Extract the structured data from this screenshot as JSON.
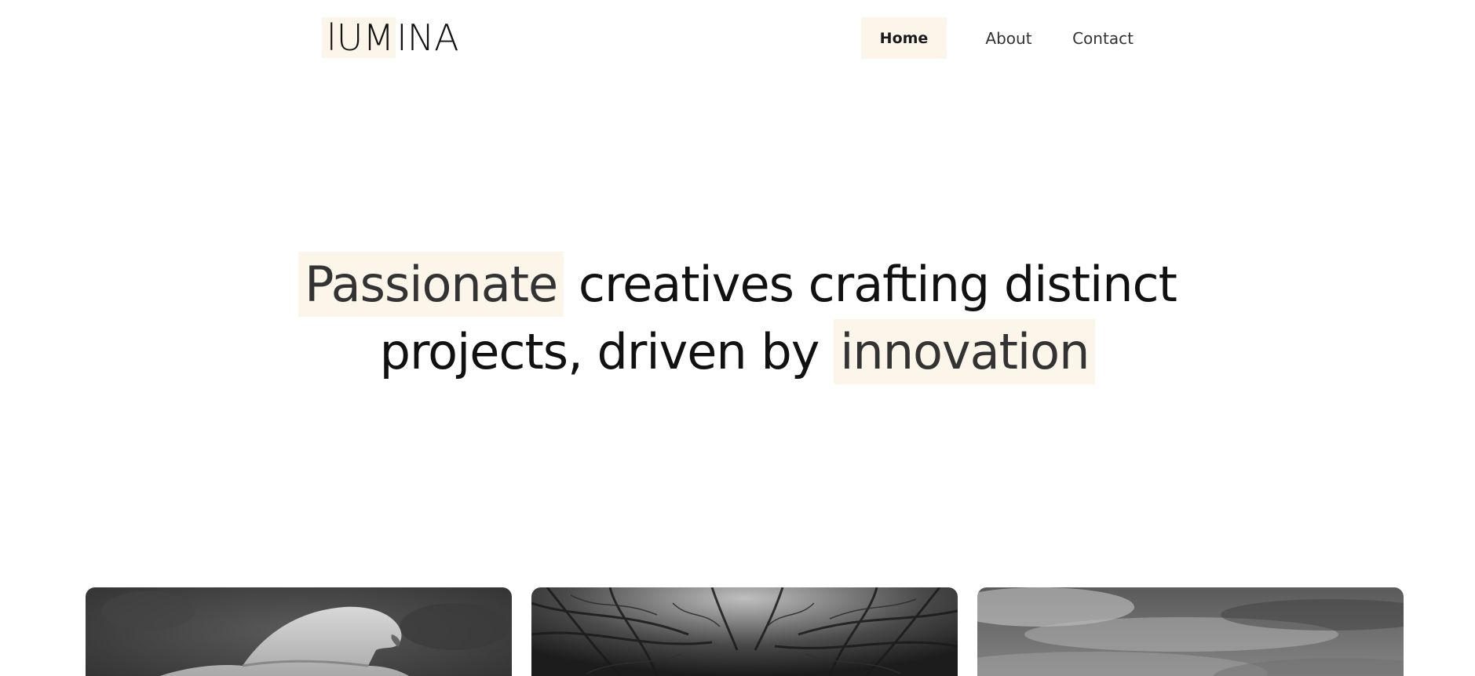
{
  "logo": {
    "highlight": "lUM",
    "rest": "INA"
  },
  "nav": {
    "items": [
      {
        "label": "Home",
        "active": true
      },
      {
        "label": "About",
        "active": false
      },
      {
        "label": "Contact",
        "active": false
      }
    ]
  },
  "hero": {
    "line1_highlight": "Passionate",
    "line1_rest": " creatives crafting distinct",
    "line2_start": "projects, driven by ",
    "line2_highlight": "innovation"
  },
  "gallery": {
    "items": [
      {
        "name": "mushroom-photo"
      },
      {
        "name": "forest-tunnel-photo"
      },
      {
        "name": "cloudy-sky-photo"
      }
    ]
  },
  "colors": {
    "highlight_bg": "#fcf5ea",
    "text": "#111111",
    "muted_text": "#333333"
  }
}
